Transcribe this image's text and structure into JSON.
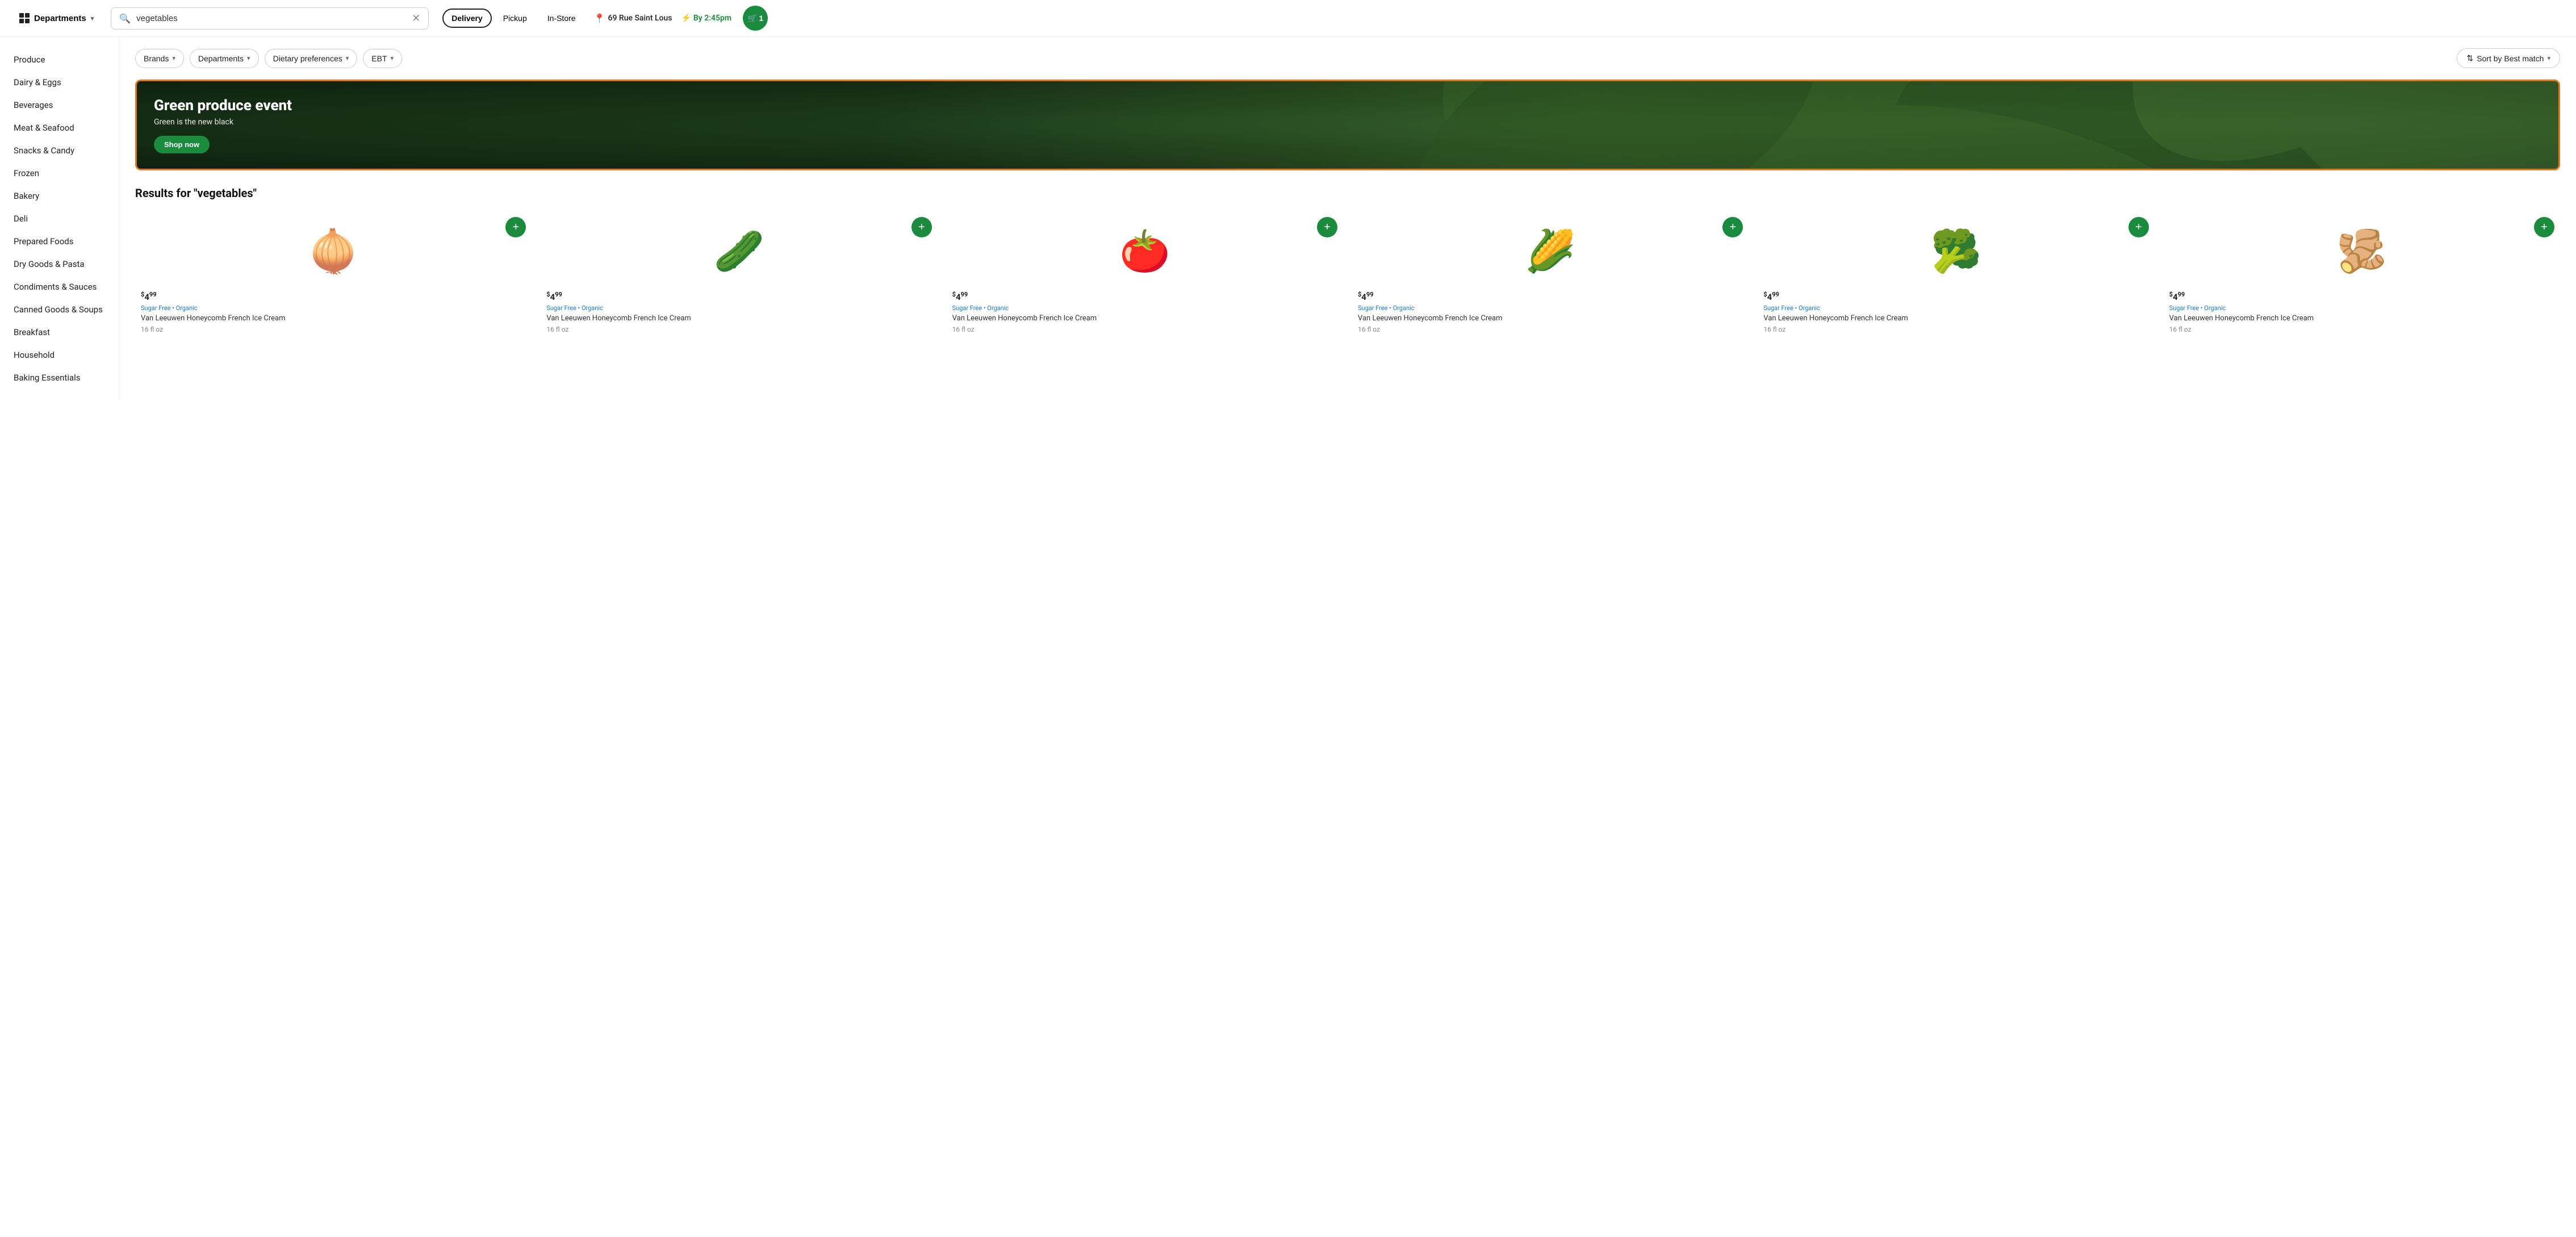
{
  "header": {
    "departments_label": "Departments",
    "search_value": "vegetables",
    "nav_items": [
      {
        "label": "Delivery",
        "active": true
      },
      {
        "label": "Pickup",
        "active": false
      },
      {
        "label": "In-Store",
        "active": false
      }
    ],
    "location": "69 Rue Saint Lous",
    "delivery_time": "By 2:45pm",
    "cart_count": "1",
    "cart_icon": "🛒"
  },
  "filters": {
    "brands_label": "Brands",
    "departments_label": "Departments",
    "dietary_label": "Dietary preferences",
    "ebt_label": "EBT",
    "sort_label": "Sort by Best match"
  },
  "banner": {
    "title": "Green produce event",
    "subtitle": "Green is the new black",
    "btn_label": "Shop now"
  },
  "results": {
    "heading": "Results for \"vegetables\""
  },
  "sidebar": {
    "items": [
      {
        "label": "Produce"
      },
      {
        "label": "Dairy & Eggs"
      },
      {
        "label": "Beverages"
      },
      {
        "label": "Meat & Seafood"
      },
      {
        "label": "Snacks & Candy"
      },
      {
        "label": "Frozen"
      },
      {
        "label": "Bakery"
      },
      {
        "label": "Deli"
      },
      {
        "label": "Prepared Foods"
      },
      {
        "label": "Dry Goods & Pasta"
      },
      {
        "label": "Condiments & Sauces"
      },
      {
        "label": "Canned Goods & Soups"
      },
      {
        "label": "Breakfast"
      },
      {
        "label": "Household"
      },
      {
        "label": "Baking Essentials"
      }
    ]
  },
  "products": [
    {
      "emoji": "🧅",
      "price_dollars": "4",
      "price_cents": "99",
      "tags": "Sugar Free • Organic",
      "name": "Van Leeuwen Honeycomb French Ice Cream",
      "size": "16 fl oz"
    },
    {
      "emoji": "🥒",
      "price_dollars": "4",
      "price_cents": "99",
      "tags": "Sugar Free • Organic",
      "name": "Van Leeuwen Honeycomb French Ice Cream",
      "size": "16 fl oz"
    },
    {
      "emoji": "🍅",
      "price_dollars": "4",
      "price_cents": "99",
      "tags": "Sugar Free • Organic",
      "name": "Van Leeuwen Honeycomb French Ice Cream",
      "size": "16 fl oz"
    },
    {
      "emoji": "🌽",
      "price_dollars": "4",
      "price_cents": "99",
      "tags": "Sugar Free • Organic",
      "name": "Van Leeuwen Honeycomb French Ice Cream",
      "size": "16 fl oz"
    },
    {
      "emoji": "🥦",
      "price_dollars": "4",
      "price_cents": "99",
      "tags": "Sugar Free • Organic",
      "name": "Van Leeuwen Honeycomb French Ice Cream",
      "size": "16 fl oz"
    },
    {
      "emoji": "🫚",
      "price_dollars": "4",
      "price_cents": "99",
      "tags": "Sugar Free • Organic",
      "name": "Van Leeuwen Honeycomb French Ice Cream",
      "size": "16 fl oz"
    }
  ],
  "colors": {
    "brand_green": "#1a8a3c",
    "banner_border": "#e07820",
    "tag_blue": "#1a7ac7"
  }
}
